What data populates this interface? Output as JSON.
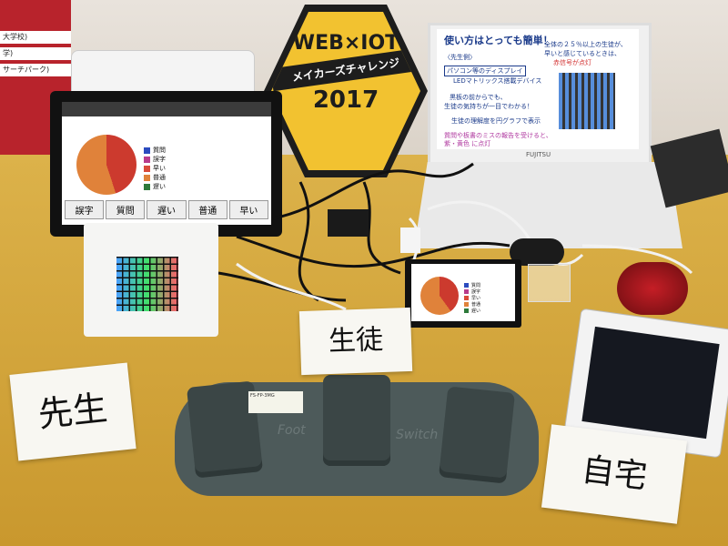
{
  "scene": {
    "description_colors": {
      "table": "#cfa63a",
      "wall": "#e2dbd2",
      "poster": "#b8232c"
    }
  },
  "poster": {
    "lines": [
      "大学校)",
      "学)",
      "サーチパーク)"
    ]
  },
  "hex_sign": {
    "line1": "WEB×IOT",
    "band": "メイカーズチャレンジ",
    "year": "2017"
  },
  "monitor": {
    "legend": [
      "質問",
      "誤字",
      "早い",
      "普通",
      "遅い"
    ],
    "legend_colors": [
      "#2b4bbf",
      "#b83c8c",
      "#d94b3a",
      "#e0823a",
      "#2d7a3a"
    ],
    "buttons": [
      "誤字",
      "質問",
      "遅い",
      "普通",
      "早い"
    ]
  },
  "laptop": {
    "title": "使い方はとっても簡単！",
    "lines": [
      "全体の２５％以上の生徒が、",
      "早いと感じているときは、",
      "赤信号が点灯",
      "〈先生側〉",
      "パソコン等のディスプレイ",
      "LEDマトリックス搭載デバイス",
      "黒板の前からでも、",
      "生徒の気持ちが一目でわかる！",
      "生徒の理解度を円グラフで表示",
      "質問や板書のミスの報告を受けると、",
      "紫・黄色 に点灯"
    ],
    "brand": "FUJITSU"
  },
  "small_screen": {
    "legend": [
      "質問",
      "誤字",
      "早い",
      "普通",
      "遅い"
    ]
  },
  "foot_switch": {
    "label": "FS-FP-3MG",
    "text1": "Foot",
    "text2": "Switch"
  },
  "cards": {
    "sensei": "先生",
    "seito": "生徒",
    "jitaku": "自宅"
  }
}
